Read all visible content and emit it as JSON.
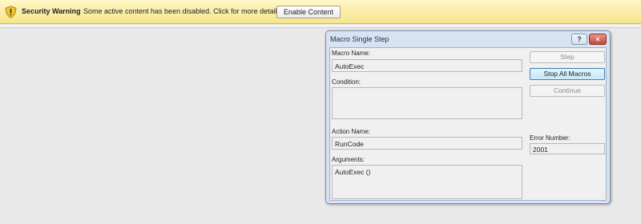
{
  "security_bar": {
    "icon": "warning-shield-icon",
    "title": "Security Warning",
    "message": "Some active content has been disabled. Click for more details.",
    "button_label": "Enable Content"
  },
  "dialog": {
    "title": "Macro Single Step",
    "help_label": "?",
    "close_label": "×",
    "macro_name_label": "Macro Name:",
    "macro_name_value": "AutoExec",
    "condition_label": "Condition:",
    "condition_value": "",
    "action_name_label": "Action Name:",
    "action_name_value": "RunCode",
    "arguments_label": "Arguments:",
    "arguments_value": "AutoExec ()",
    "error_number_label": "Error Number:",
    "error_number_value": "2001",
    "buttons": {
      "step": "Step",
      "stop_all": "Stop All Macros",
      "continue": "Continue"
    }
  },
  "colors": {
    "bar_background": "#f7e58a",
    "dialog_frame": "#d7e3f2",
    "default_button_border": "#3c7fb1"
  }
}
